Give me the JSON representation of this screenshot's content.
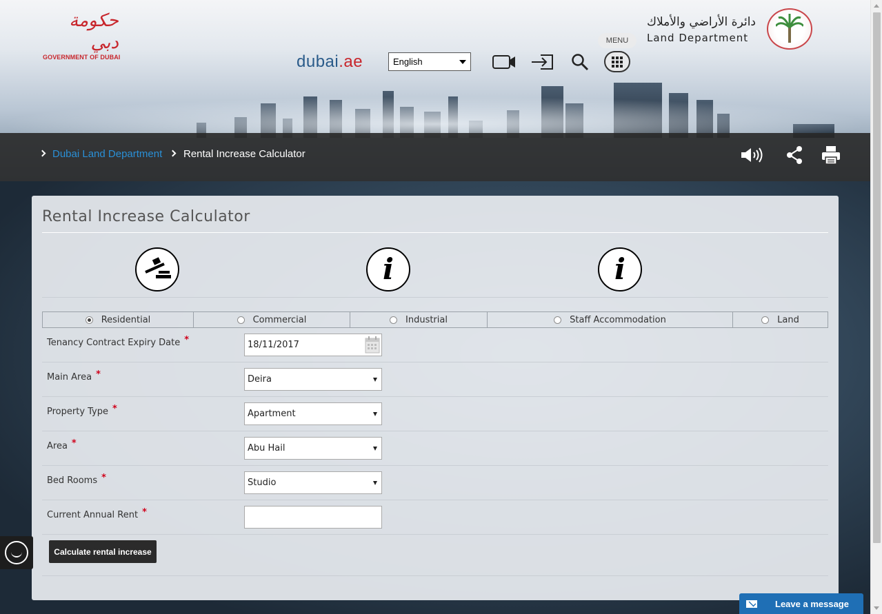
{
  "header": {
    "gov_logo_arabic": "حكومة دبي",
    "gov_logo_english": "GOVERNMENT OF DUBAI",
    "dld_logo_arabic": "دائرة الأراضي والأملاك",
    "dld_logo_english": "Land Department",
    "menu_label": "MENU",
    "portal_logo": "dubai",
    "portal_logo_suffix": ".ae",
    "language_selected": "English",
    "icons": [
      "video-icon",
      "login-icon",
      "search-icon",
      "apps-grid-icon"
    ]
  },
  "breadcrumb": {
    "items": [
      {
        "label": "Dubai Land Department",
        "link": true
      },
      {
        "label": "Rental Increase Calculator",
        "link": false
      }
    ],
    "tools": [
      "speaker-icon",
      "share-icon",
      "print-icon"
    ]
  },
  "calculator": {
    "title": "Rental Increase Calculator",
    "icons": [
      "gavel-icon",
      "info-icon",
      "info-icon"
    ],
    "property_categories": [
      {
        "label": "Residential",
        "selected": true
      },
      {
        "label": "Commercial",
        "selected": false
      },
      {
        "label": "Industrial",
        "selected": false
      },
      {
        "label": "Staff Accommodation",
        "selected": false
      },
      {
        "label": "Land",
        "selected": false
      }
    ],
    "fields": [
      {
        "label": "Tenancy Contract Expiry Date",
        "value": "18/11/2017",
        "type": "date"
      },
      {
        "label": "Main Area",
        "value": "Deira",
        "type": "select"
      },
      {
        "label": "Property Type",
        "value": "Apartment",
        "type": "select"
      },
      {
        "label": "Area",
        "value": "Abu Hail",
        "type": "select"
      },
      {
        "label": "Bed Rooms",
        "value": "Studio",
        "type": "select"
      },
      {
        "label": "Current Annual Rent",
        "value": "",
        "type": "text"
      }
    ],
    "required_marker": "*",
    "submit_label": "Calculate rental increase"
  },
  "chat": {
    "label": "Leave a message"
  },
  "colors": {
    "accent_link": "#2a8fd6",
    "required": "#d0021b",
    "brand_red": "#c8262c",
    "chat_blue": "#1f6fb5"
  }
}
